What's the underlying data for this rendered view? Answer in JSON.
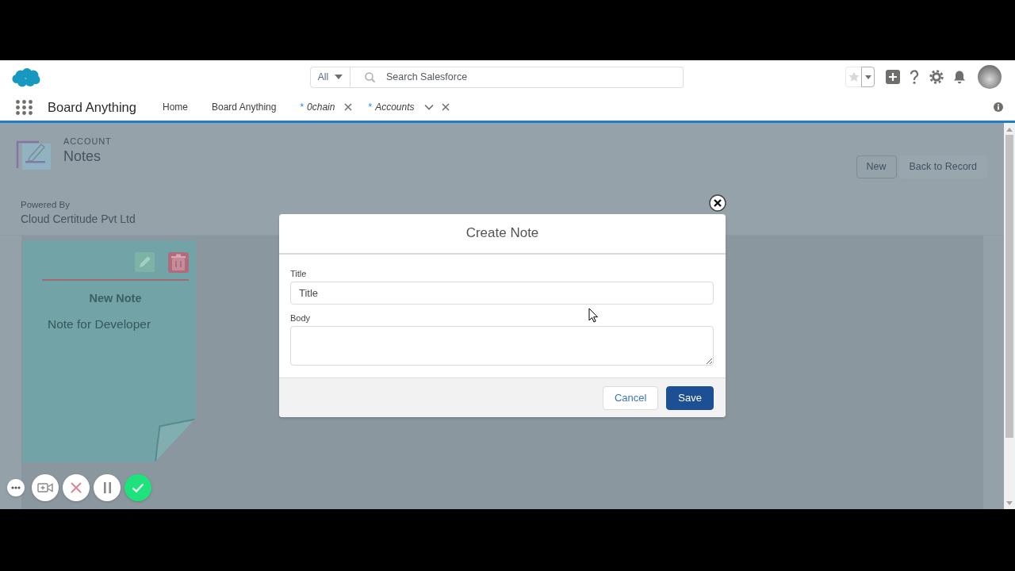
{
  "global_header": {
    "search_scope": "All",
    "search_placeholder": "Search Salesforce"
  },
  "navigation": {
    "app_name": "Board Anything",
    "tabs": [
      {
        "label": "Home",
        "kind": "item",
        "selected": false,
        "closable": false,
        "menu": false
      },
      {
        "label": "Board Anything",
        "kind": "item",
        "selected": false,
        "closable": false,
        "menu": false
      },
      {
        "prefix": "*",
        "label": "0chain",
        "kind": "workspace",
        "selected": false,
        "closable": true,
        "menu": false
      },
      {
        "prefix": "*",
        "label": "Accounts",
        "kind": "workspace",
        "selected": false,
        "closable": true,
        "menu": true
      }
    ]
  },
  "page_header": {
    "object_label": "ACCOUNT",
    "title": "Notes",
    "buttons": [
      {
        "label": "New",
        "kind": "neutral"
      },
      {
        "label": "Back to Record",
        "kind": "bare"
      }
    ],
    "powered_by_label": "Powered By",
    "powered_by": "Cloud Certitude Pvt Ltd"
  },
  "notes": [
    {
      "title": "New Note",
      "body": "Note for Developer"
    }
  ],
  "modal": {
    "title": "Create Note",
    "fields": [
      {
        "label": "Title",
        "kind": "input",
        "placeholder": "Title"
      },
      {
        "label": "Body",
        "kind": "textarea"
      }
    ],
    "buttons": [
      {
        "label": "Cancel",
        "kind": "neutral"
      },
      {
        "label": "Save",
        "kind": "brand"
      }
    ]
  },
  "recorder_controls": [
    {
      "kind": "more"
    },
    {
      "kind": "camera"
    },
    {
      "kind": "discard"
    },
    {
      "kind": "pause"
    },
    {
      "kind": "done"
    }
  ]
}
